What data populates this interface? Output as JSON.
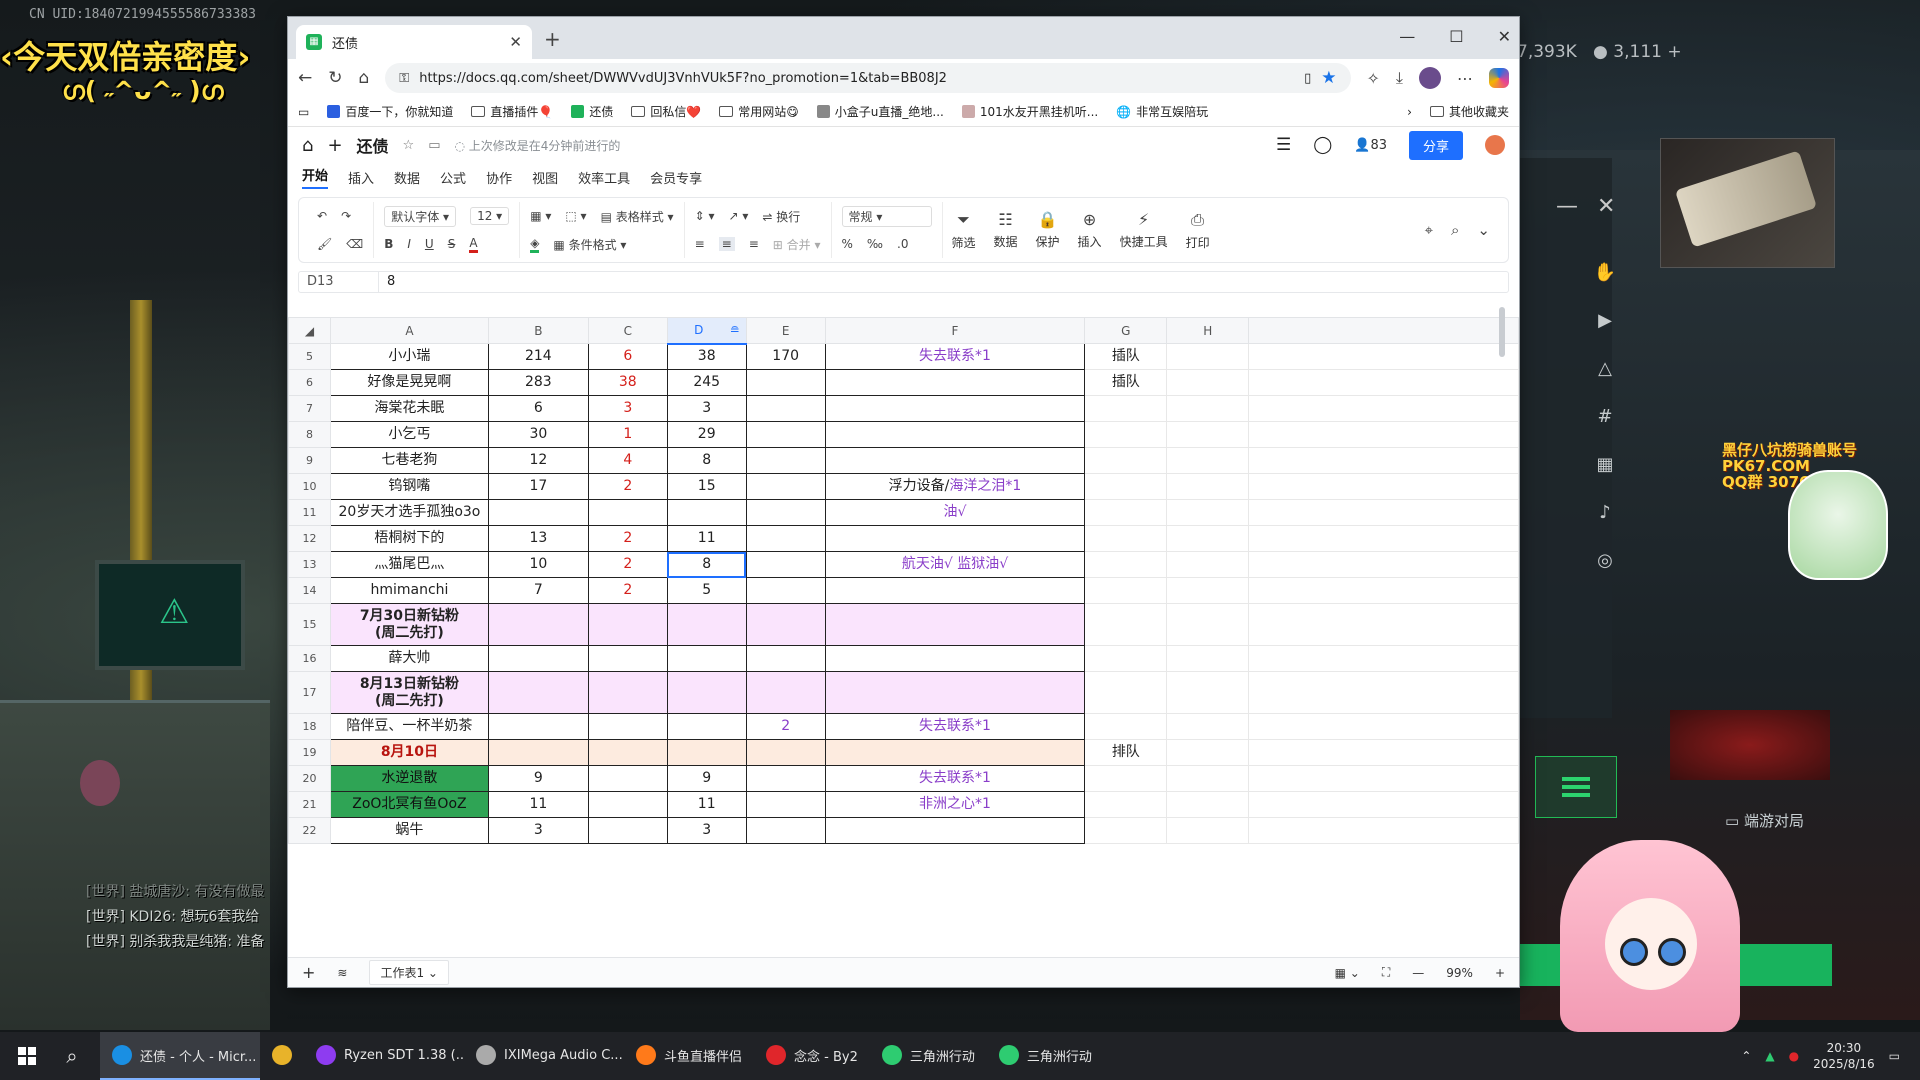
{
  "overlay": {
    "uid": "CN UID:1840721994555586733383",
    "promo": "‹今天双倍亲密度›",
    "promo_face": "ഗ( ˶^ᴗ^˶ )ഗ",
    "stats_left": "7,393K",
    "stats_right": "3,111 +",
    "watermark_line1": "黑仔八坑捞骑兽账号",
    "watermark_line2": "PK67.COM",
    "watermark_line3": "QQ群 307682142",
    "mode_label": "端游对局",
    "chat": [
      {
        "text": "[世界] 盐城唐沙: 有没有做最",
        "faded": true
      },
      {
        "text": "[世界] KDI26: 想玩6套我给",
        "faded": false
      },
      {
        "text": "[世界] 别杀我我是纯猪: 准备",
        "faded": false
      }
    ]
  },
  "browser": {
    "tab_title": "还债",
    "url": "https://docs.qq.com/sheet/DWWVvdUJ3VnhVUk5F?no_promotion=1&tab=BB08J2",
    "bookmarks": [
      "百度一下，你就知道",
      "直播插件🎈",
      "还债",
      "回私信❤️",
      "常用网站😋",
      "小盒子u直播_绝地...",
      "101水友开黑挂机听...",
      "非常互娱陪玩"
    ],
    "bookmarks_more": "其他收藏夹"
  },
  "doc": {
    "title": "还债",
    "save_status": "上次修改是在4分钟前进行的",
    "collaborators": "83",
    "share_label": "分享",
    "menus": [
      "开始",
      "插入",
      "数据",
      "公式",
      "协作",
      "视图",
      "效率工具",
      "会员专享"
    ],
    "toolbar": {
      "font": "默认字体",
      "size": "12",
      "table_style": "表格样式",
      "wrap": "换行",
      "format": "常规",
      "cond_format": "条件格式",
      "merge": "合并",
      "percent": "%",
      "decimal": ".0",
      "filter": "筛选",
      "data": "数据",
      "protect": "保护",
      "insert": "插入",
      "quick_tools": "快捷工具",
      "print": "打印"
    },
    "cell_ref": "D13",
    "formula_value": "8",
    "columns": [
      "A",
      "B",
      "C",
      "D",
      "E",
      "F",
      "G",
      "H"
    ],
    "rows": [
      {
        "n": "5",
        "a": "小小瑞",
        "b": "214",
        "c": "6",
        "d": "38",
        "e": "170",
        "f": "失去联系*1",
        "g": "插队",
        "h": "",
        "style": ""
      },
      {
        "n": "6",
        "a": "好像是晃晃啊",
        "b": "283",
        "c": "38",
        "d": "245",
        "e": "",
        "f": "",
        "g": "插队",
        "h": "",
        "style": ""
      },
      {
        "n": "7",
        "a": "海棠花未眠",
        "b": "6",
        "c": "3",
        "d": "3",
        "e": "",
        "f": "",
        "g": "",
        "h": "",
        "style": ""
      },
      {
        "n": "8",
        "a": "小乞丐",
        "b": "30",
        "c": "1",
        "d": "29",
        "e": "",
        "f": "",
        "g": "",
        "h": "",
        "style": ""
      },
      {
        "n": "9",
        "a": "七巷老狗",
        "b": "12",
        "c": "4",
        "d": "8",
        "e": "",
        "f": "",
        "g": "",
        "h": "",
        "style": ""
      },
      {
        "n": "10",
        "a": "钨钢嘴",
        "b": "17",
        "c": "2",
        "d": "15",
        "e": "",
        "f_plain": "浮力设备/",
        "f": "海洋之泪*1",
        "g": "",
        "h": "",
        "style": ""
      },
      {
        "n": "11",
        "a": "20岁天才选手孤独o3o",
        "b": "",
        "c": "",
        "d": "",
        "e": "",
        "f": "油√",
        "g": "",
        "h": "",
        "style": ""
      },
      {
        "n": "12",
        "a": "梧桐树下的",
        "b": "13",
        "c": "2",
        "d": "11",
        "e": "",
        "f": "",
        "g": "",
        "h": "",
        "style": ""
      },
      {
        "n": "13",
        "a": "灬猫尾巴灬",
        "b": "10",
        "c": "2",
        "d": "8",
        "e": "",
        "f": "航天油√ 监狱油√",
        "g": "",
        "h": "",
        "style": "",
        "selected": true
      },
      {
        "n": "14",
        "a": "hmimanchi",
        "b": "7",
        "c": "2",
        "d": "5",
        "e": "",
        "f": "",
        "g": "",
        "h": "",
        "style": ""
      },
      {
        "n": "15",
        "a": "7月30日新钻粉\n(周二先打)",
        "b": "",
        "c": "",
        "d": "",
        "e": "",
        "f": "",
        "g": "",
        "h": "",
        "style": "pink-header",
        "tall": true
      },
      {
        "n": "16",
        "a": "薛大帅",
        "b": "",
        "c": "",
        "d": "",
        "e": "",
        "f": "",
        "g": "",
        "h": "",
        "style": ""
      },
      {
        "n": "17",
        "a": "8月13日新钻粉\n(周二先打)",
        "b": "",
        "c": "",
        "d": "",
        "e": "",
        "f": "",
        "g": "",
        "h": "",
        "style": "pink-header",
        "tall": true
      },
      {
        "n": "18",
        "a": "陪伴豆、一杯半奶茶",
        "b": "",
        "c": "",
        "d": "",
        "e": "2",
        "f": "失去联系*1",
        "g": "",
        "h": "",
        "style": ""
      },
      {
        "n": "19",
        "a": "8月10日",
        "b": "",
        "c": "",
        "d": "",
        "e": "",
        "f": "",
        "g": "排队",
        "h": "",
        "style": "peach-header"
      },
      {
        "n": "20",
        "a": "水逆退散",
        "b": "9",
        "c": "",
        "d": "9",
        "e": "",
        "f": "失去联系*1",
        "g": "",
        "h": "",
        "style": "green"
      },
      {
        "n": "21",
        "a": "ZoO北冥有鱼OoZ",
        "b": "11",
        "c": "",
        "d": "11",
        "e": "",
        "f": "非洲之心*1",
        "g": "",
        "h": "",
        "style": "green"
      },
      {
        "n": "22",
        "a": "蜗牛",
        "b": "3",
        "c": "",
        "d": "3",
        "e": "",
        "f": "",
        "g": "",
        "h": "",
        "style": ""
      }
    ],
    "sheet_tab": "工作表1",
    "zoom": "99%"
  },
  "taskbar": {
    "items": [
      {
        "label": "还债 - 个人 - Micr...",
        "active": true,
        "color": "#1a8fe3"
      },
      {
        "label": "",
        "active": false,
        "color": "#e8b32a"
      },
      {
        "label": "Ryzen SDT 1.38 (...",
        "active": false,
        "color": "#8e3cf0"
      },
      {
        "label": "IXIMega Audio C...",
        "active": false,
        "color": "#aaaaaa"
      },
      {
        "label": "斗鱼直播伴侣",
        "active": false,
        "color": "#ff7a1a"
      },
      {
        "label": "念念 - By2",
        "active": false,
        "color": "#e0262b"
      },
      {
        "label": "三角洲行动",
        "active": false,
        "color": "#2ecc71"
      },
      {
        "label": "三角洲行动",
        "active": false,
        "color": "#2ecc71"
      }
    ],
    "time": "20:30",
    "date": "2025/8/16"
  }
}
